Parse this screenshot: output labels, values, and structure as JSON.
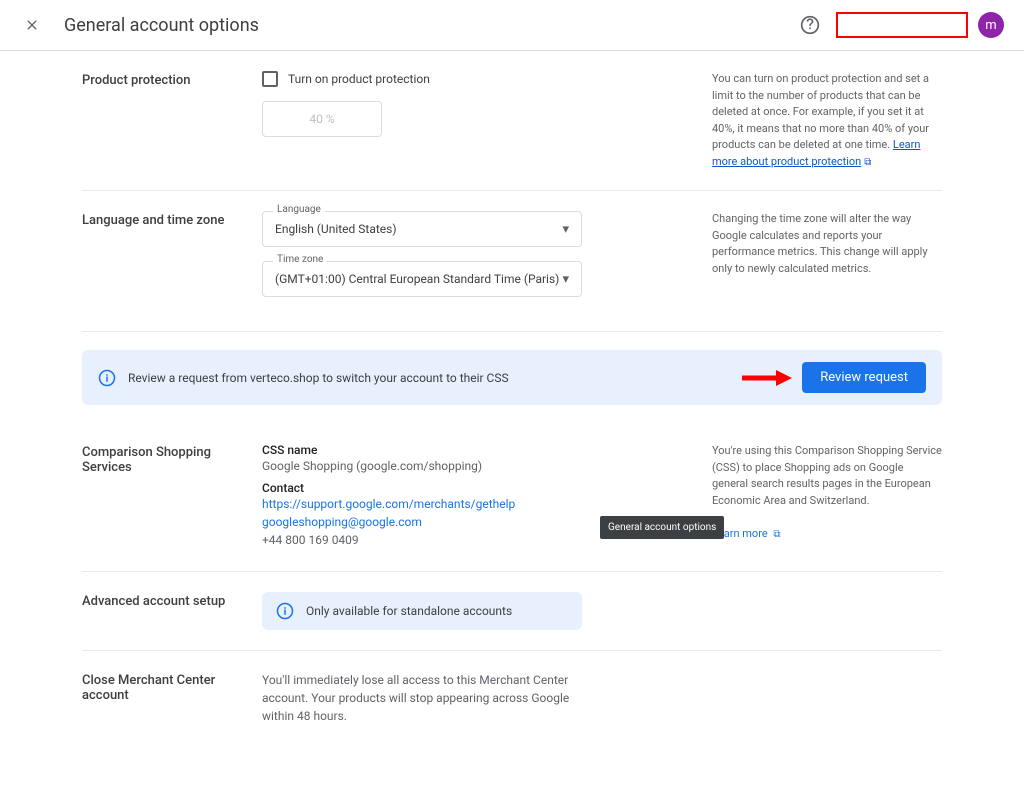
{
  "header": {
    "title": "General account options",
    "avatar_letter": "m"
  },
  "product_protection": {
    "section_label": "Product protection",
    "checkbox_label": "Turn on product protection",
    "placeholder_value": "40 %",
    "aside_text": "You can turn on product protection and set a limit to the number of products that can be deleted at once. For example, if you set it at 40%, it means that no more than 40% of your products can be deleted at one time. ",
    "learn_more_link": "Learn more about product protection"
  },
  "language_tz": {
    "section_label": "Language and time zone",
    "language_legend": "Language",
    "language_value": "English (United States)",
    "timezone_legend": "Time zone",
    "timezone_value": "(GMT+01:00) Central European Standard Time (Paris)",
    "aside_text": "Changing the time zone will alter the way Google calculates and reports your performance metrics. This change will apply only to newly calculated metrics."
  },
  "review_notice": {
    "text": "Review a request from verteco.shop to switch your account to their CSS",
    "button": "Review request"
  },
  "css": {
    "section_label": "Comparison Shopping Services",
    "css_name_label": "CSS name",
    "css_name_value": "Google Shopping (google.com/shopping)",
    "contact_label": "Contact",
    "contact_url": "https://support.google.com/merchants/gethelp",
    "contact_email": "googleshopping@google.com",
    "contact_phone": "+44 800 169 0409",
    "aside_text": "You're using this Comparison Shopping Service (CSS) to place Shopping ads on Google general search results pages in the European Economic Area and Switzerland.",
    "learn_more": "Learn more",
    "tooltip": "General account options"
  },
  "advanced": {
    "section_label": "Advanced account setup",
    "notice": "Only available for standalone accounts"
  },
  "close_account": {
    "section_label": "Close Merchant Center account",
    "text": "You'll immediately lose all access to this Merchant Center account. Your products will stop appearing across Google within 48 hours."
  }
}
